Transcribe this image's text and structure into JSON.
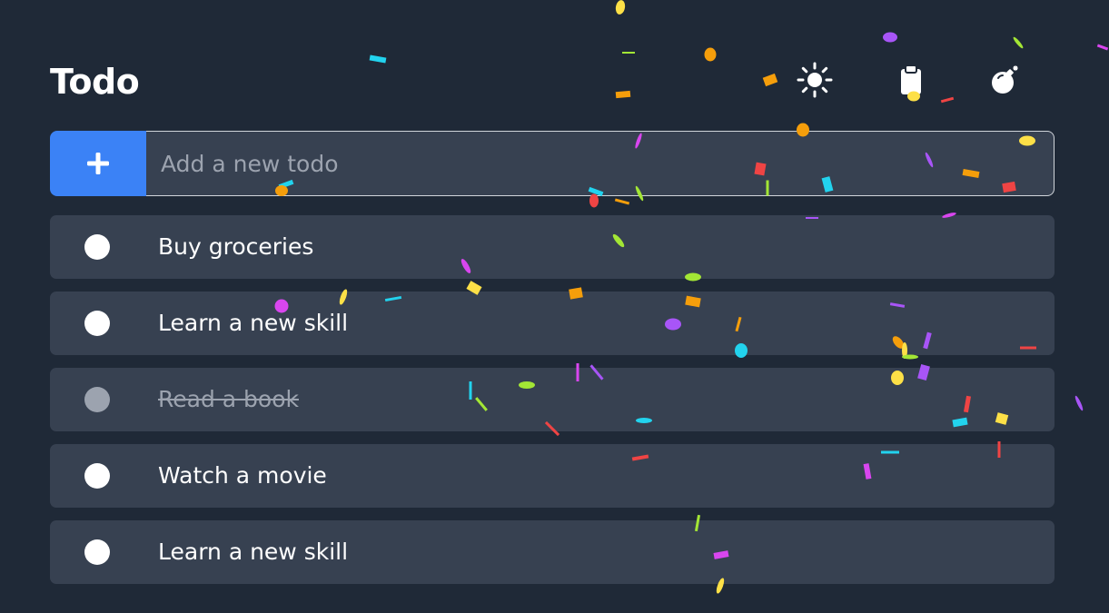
{
  "app": {
    "title": "Todo"
  },
  "header": {
    "icons": [
      "sun-icon",
      "clipboard-icon",
      "bomb-icon"
    ]
  },
  "add_form": {
    "button_icon": "plus-icon",
    "placeholder": "Add a new todo",
    "value": ""
  },
  "todos": [
    {
      "text": "Buy groceries",
      "completed": false
    },
    {
      "text": "Learn a new skill",
      "completed": false
    },
    {
      "text": "Read a book",
      "completed": true
    },
    {
      "text": "Watch a movie",
      "completed": false
    },
    {
      "text": "Learn a new skill",
      "completed": false
    }
  ],
  "colors": {
    "background": "#1f2937",
    "card": "#374151",
    "accent": "#3b82f6",
    "text": "#ffffff",
    "muted": "#9ca3af",
    "confetti": [
      "#fde047",
      "#f59e0b",
      "#a855f7",
      "#a3e635",
      "#d946ef",
      "#22d3ee",
      "#ef4444"
    ]
  }
}
